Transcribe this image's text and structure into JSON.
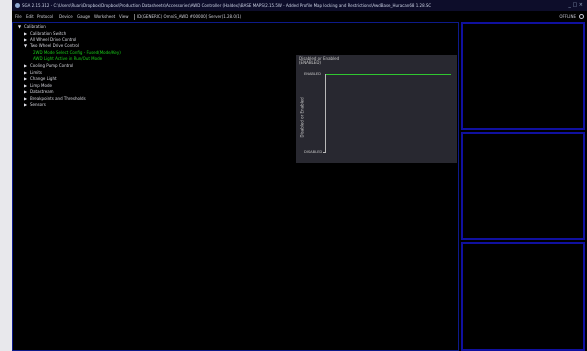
{
  "window": {
    "title": "SGA 2.15.312 - C:\\Users\\Ruan\\Dropbox\\Dropbox\\Production Datasheets\\Accessories\\AWD Controller (Haldex)\\BASE MAPS\\2.15.5W - Added Profile Map locking and Restrictions\\AwdBase_Huracan68 1.28.SC",
    "controls": "_ □ ×"
  },
  "menubar": {
    "items": [
      "File",
      "Edit",
      "Protocol",
      "Device",
      "Gauge",
      "Worksheet",
      "View"
    ],
    "device_info": "ID(GENERIC) OmniS_AWD #00000] Server(1.28.0/1)",
    "status": "OFFLINE"
  },
  "tree": {
    "items": [
      {
        "label": "Calibration",
        "arrow": "▼",
        "indent": 0,
        "highlight": false
      },
      {
        "label": "Calibration Switch",
        "arrow": "▶",
        "indent": 1,
        "highlight": false
      },
      {
        "label": "All Wheel Drive Control",
        "arrow": "▶",
        "indent": 1,
        "highlight": false
      },
      {
        "label": "Two Wheel Drive Control",
        "arrow": "▼",
        "indent": 1,
        "highlight": false
      },
      {
        "label": "2WD Mode Select Config - Fused(Mode/Key)",
        "arrow": "",
        "indent": 2,
        "highlight": true
      },
      {
        "label": "AWD Light Active in Run/Out Mode",
        "arrow": "",
        "indent": 2,
        "highlight": true
      },
      {
        "label": "Cooling Pump Control",
        "arrow": "▶",
        "indent": 1,
        "highlight": false
      },
      {
        "label": "Limits",
        "arrow": "▶",
        "indent": 1,
        "highlight": false
      },
      {
        "label": "Change Light",
        "arrow": "▶",
        "indent": 1,
        "highlight": false
      },
      {
        "label": "Limp Mode",
        "arrow": "▶",
        "indent": 1,
        "highlight": false
      },
      {
        "label": "Datastream",
        "arrow": "▶",
        "indent": 1,
        "highlight": false
      },
      {
        "label": "Breakpoints and Thresholds",
        "arrow": "▶",
        "indent": 1,
        "highlight": false
      },
      {
        "label": "Sensors",
        "arrow": "▶",
        "indent": 1,
        "highlight": false
      }
    ]
  },
  "graph": {
    "title": "Disabled or Enabled",
    "current_value": "(ENABLED)",
    "ylabel": "Disabled or Enabled",
    "ytick_top": "ENABLED",
    "ytick_bottom": "DISABLED",
    "value": "ENABLED",
    "colors": {
      "line": "#30c830",
      "panel": "#282830"
    }
  },
  "colors": {
    "accent_border": "#1010a0",
    "highlight_text": "#18d018"
  }
}
